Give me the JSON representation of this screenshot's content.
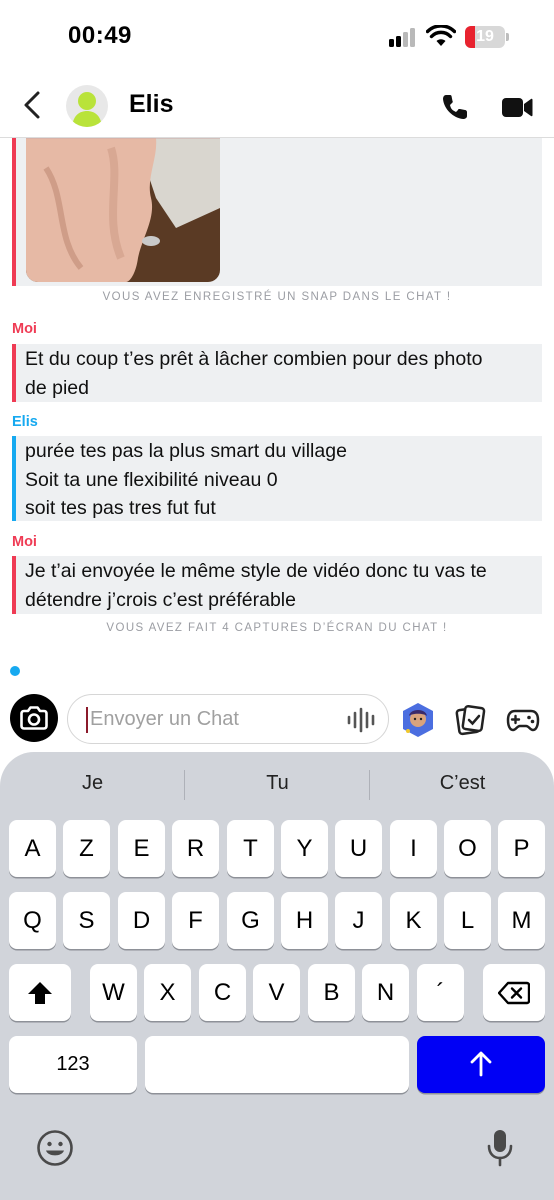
{
  "status_bar": {
    "time": "00:49",
    "battery": "19",
    "battery_level": 0.19
  },
  "header": {
    "contact_name": "Elis"
  },
  "chat": {
    "snap_saved_note": "VOUS AVEZ ENREGISTRÉ UN SNAP DANS LE CHAT !",
    "messages": [
      {
        "sender": "Moi",
        "lines": [
          "Et du coup t’es prêt à lâcher combien pour des photo",
          "de pied"
        ]
      },
      {
        "sender": "Elis",
        "lines": [
          "purée tes pas la plus smart du village",
          "Soit ta une flexibilité niveau 0",
          "soit tes pas tres fut fut"
        ]
      },
      {
        "sender": "Moi",
        "lines": [
          "Je t’ai envoyée le même style de vidéo donc tu vas te",
          "détendre j’crois c’est préférable"
        ]
      }
    ],
    "screenshot_note": "VOUS AVEZ FAIT 4 CAPTURES D’ÉCRAN DU CHAT !"
  },
  "composer": {
    "placeholder": "Envoyer un Chat"
  },
  "keyboard": {
    "suggestions": [
      "Je",
      "Tu",
      "C’est"
    ],
    "row1": [
      "A",
      "Z",
      "E",
      "R",
      "T",
      "Y",
      "U",
      "I",
      "O",
      "P"
    ],
    "row2": [
      "Q",
      "S",
      "D",
      "F",
      "G",
      "H",
      "J",
      "K",
      "L",
      "M"
    ],
    "row3": [
      "W",
      "X",
      "C",
      "V",
      "B",
      "N",
      "´"
    ],
    "numbers_key": "123"
  },
  "colors": {
    "me": "#ef3b54",
    "elis": "#16a9f0",
    "return_key": "#0000f5",
    "bubble_bg": "#eef0f2",
    "keyboard_bg": "#d1d4da"
  },
  "icons": [
    "back-chevron-icon",
    "avatar-icon",
    "phone-icon",
    "video-camera-icon",
    "camera-icon",
    "voice-note-icon",
    "bitmoji-icon",
    "sticker-icon",
    "game-controller-icon",
    "shift-icon",
    "backspace-icon",
    "return-arrow-icon",
    "emoji-icon",
    "microphone-icon"
  ]
}
